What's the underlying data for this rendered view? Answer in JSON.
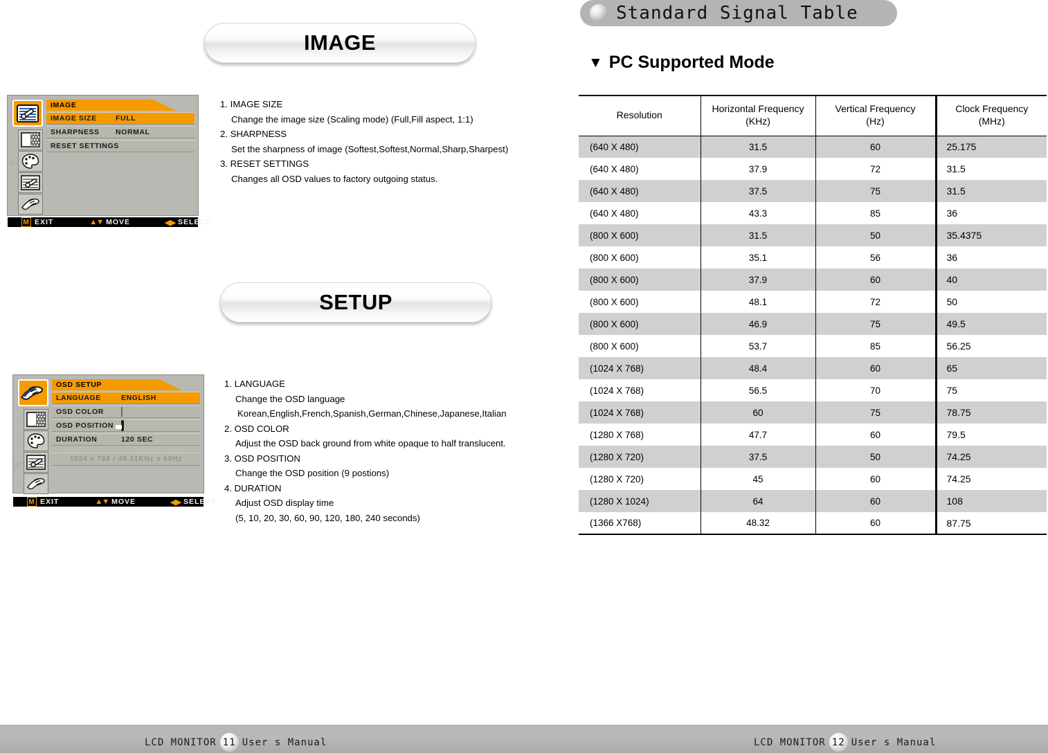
{
  "left_page": {
    "banners": {
      "image": "IMAGE",
      "setup": "SETUP"
    },
    "osd_image": {
      "title": "IMAGE",
      "rows": [
        {
          "label": "IMAGE SIZE",
          "value": "FULL",
          "selected": true
        },
        {
          "label": "SHARPNESS",
          "value": "NORMAL",
          "selected": false
        },
        {
          "label": "RESET SETTINGS",
          "value": "",
          "selected": false
        }
      ],
      "footer": {
        "exit_key": "M",
        "exit": "EXIT",
        "move": "MOVE",
        "select": "SELECT"
      }
    },
    "osd_setup": {
      "title": "OSD SETUP",
      "rows": [
        {
          "label": "LANGUAGE",
          "value": "ENGLISH",
          "selected": true
        },
        {
          "label": "OSD COLOR",
          "value": "",
          "selected": false
        },
        {
          "label": "OSD POSITION",
          "value": "",
          "selected": false
        },
        {
          "label": "DURATION",
          "value": "120 SEC",
          "selected": false
        }
      ],
      "info": "1024 x 768 / 48.31KHz x 60Hz",
      "footer": {
        "exit_key": "M",
        "exit": "EXIT",
        "move": "MOVE",
        "select": "SELECT"
      }
    },
    "desc_image": [
      {
        "type": "num",
        "text": "1. IMAGE SIZE"
      },
      {
        "type": "sub",
        "text": "Change the image size (Scaling mode) (Full,Fill aspect, 1:1)"
      },
      {
        "type": "num",
        "text": "2. SHARPNESS"
      },
      {
        "type": "sub",
        "text": "Set the sharpness of image (Softest,Softest,Normal,Sharp,Sharpest)"
      },
      {
        "type": "num",
        "text": "3. RESET SETTINGS"
      },
      {
        "type": "sub",
        "text": "Changes all OSD values to factory outgoing status."
      }
    ],
    "desc_setup": [
      {
        "type": "num",
        "text": "1. LANGUAGE"
      },
      {
        "type": "sub",
        "text": "Change the OSD language"
      },
      {
        "type": "sub2",
        "text": "Korean,English,French,Spanish,German,Chinese,Japanese,Italian"
      },
      {
        "type": "num",
        "text": "2. OSD COLOR"
      },
      {
        "type": "sub",
        "text": "Adjust the OSD back ground from white opaque to half translucent."
      },
      {
        "type": "num",
        "text": "3. OSD POSITION"
      },
      {
        "type": "sub",
        "text": "Change the OSD position (9 postions)"
      },
      {
        "type": "num",
        "text": "4. DURATION"
      },
      {
        "type": "sub",
        "text": "Adjust OSD display time"
      },
      {
        "type": "sub",
        "text": "(5, 10, 20, 30, 60, 90, 120, 180, 240 seconds)"
      }
    ],
    "footer": {
      "prefix": "LCD  MONITOR",
      "page": "11",
      "suffix": "User s Manual"
    }
  },
  "right_page": {
    "pill_title": "Standard Signal Table",
    "section_title": "PC Supported Mode",
    "footer": {
      "prefix": "LCD  MONITOR",
      "page": "12",
      "suffix": "User s Manual"
    },
    "chart_data": {
      "type": "table",
      "title": "PC Supported Mode",
      "columns": [
        "Resolution",
        "Horizontal Frequency\n(KHz)",
        "Vertical Frequency\n(Hz)",
        "Clock Frequency\n(MHz)"
      ],
      "column_headers": [
        {
          "line1": "Resolution",
          "line2": ""
        },
        {
          "line1": "Horizontal Frequency",
          "line2": "(KHz)"
        },
        {
          "line1": "Vertical Frequency",
          "line2": "(Hz)"
        },
        {
          "line1": "Clock Frequency",
          "line2": "(MHz)"
        }
      ],
      "rows": [
        {
          "resolution": "(640 X 480)",
          "h_khz": "31.5",
          "v_hz": "60",
          "clock_mhz": "25.175"
        },
        {
          "resolution": "(640 X 480)",
          "h_khz": "37.9",
          "v_hz": "72",
          "clock_mhz": "31.5"
        },
        {
          "resolution": "(640 X 480)",
          "h_khz": "37.5",
          "v_hz": "75",
          "clock_mhz": "31.5"
        },
        {
          "resolution": "(640 X 480)",
          "h_khz": "43.3",
          "v_hz": "85",
          "clock_mhz": "36"
        },
        {
          "resolution": "(800 X 600)",
          "h_khz": "31.5",
          "v_hz": "50",
          "clock_mhz": "35.4375"
        },
        {
          "resolution": "(800 X 600)",
          "h_khz": "35.1",
          "v_hz": "56",
          "clock_mhz": "36"
        },
        {
          "resolution": "(800 X 600)",
          "h_khz": "37.9",
          "v_hz": "60",
          "clock_mhz": "40"
        },
        {
          "resolution": "(800 X 600)",
          "h_khz": "48.1",
          "v_hz": "72",
          "clock_mhz": "50"
        },
        {
          "resolution": "(800 X 600)",
          "h_khz": "46.9",
          "v_hz": "75",
          "clock_mhz": "49.5"
        },
        {
          "resolution": "(800 X 600)",
          "h_khz": "53.7",
          "v_hz": "85",
          "clock_mhz": "56.25"
        },
        {
          "resolution": "(1024 X 768)",
          "h_khz": "48.4",
          "v_hz": "60",
          "clock_mhz": "65"
        },
        {
          "resolution": "(1024 X 768)",
          "h_khz": "56.5",
          "v_hz": "70",
          "clock_mhz": "75"
        },
        {
          "resolution": "(1024 X 768)",
          "h_khz": "60",
          "v_hz": "75",
          "clock_mhz": "78.75"
        },
        {
          "resolution": "(1280 X 768)",
          "h_khz": "47.7",
          "v_hz": "60",
          "clock_mhz": "79.5"
        },
        {
          "resolution": "(1280 X 720)",
          "h_khz": "37.5",
          "v_hz": "50",
          "clock_mhz": "74.25"
        },
        {
          "resolution": "(1280 X 720)",
          "h_khz": "45",
          "v_hz": "60",
          "clock_mhz": "74.25"
        },
        {
          "resolution": "(1280 X 1024)",
          "h_khz": "64",
          "v_hz": "60",
          "clock_mhz": "108"
        },
        {
          "resolution": "(1366 X768)",
          "h_khz": "48.32",
          "v_hz": "60",
          "clock_mhz": "87.75"
        }
      ]
    }
  },
  "colors": {
    "osd_highlight": "#f59a00",
    "osd_background": "#b9b9b3",
    "table_shade": "#d0d0d0",
    "footer_band": "#b6b6b6"
  }
}
